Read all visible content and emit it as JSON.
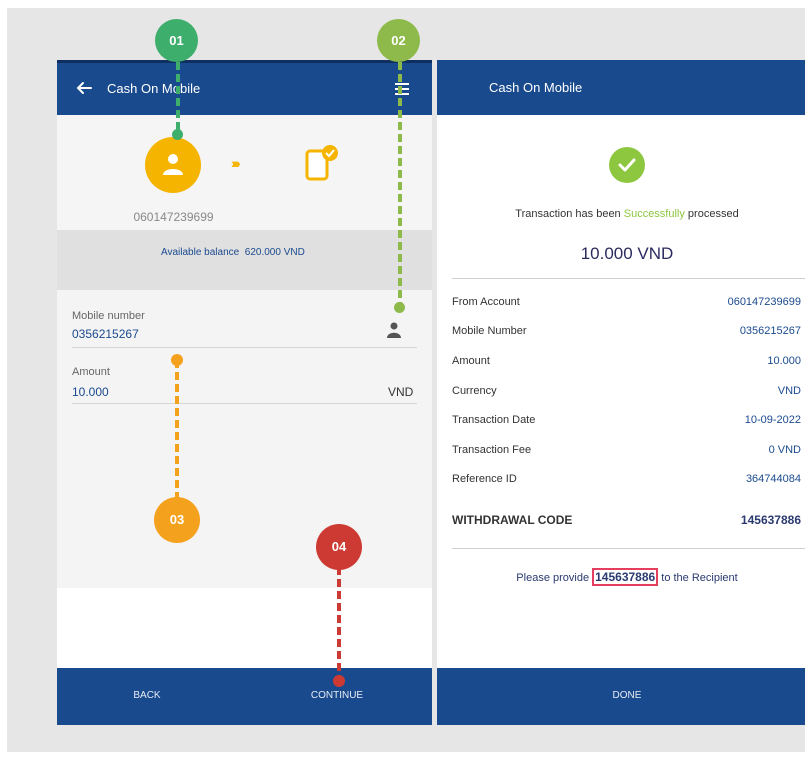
{
  "left_screen": {
    "title": "Cash On Mobile",
    "account_number": "060147239699",
    "balance_label": "Available balance",
    "balance_value": "620.000 VND",
    "mobile_label": "Mobile number",
    "mobile_value": "0356215267",
    "amount_label": "Amount",
    "amount_value": "10.000",
    "currency": "VND",
    "back_label": "BACK",
    "continue_label": "CONTINUE"
  },
  "right_screen": {
    "title": "Cash On Mobile",
    "success_prefix": "Transaction has been ",
    "success_word": "Successfully",
    "success_suffix": " processed",
    "amount": "10.000 VND",
    "details": [
      {
        "label": "From Account",
        "value": "060147239699"
      },
      {
        "label": "Mobile Number",
        "value": "0356215267"
      },
      {
        "label": "Amount",
        "value": "10.000"
      },
      {
        "label": "Currency",
        "value": "VND"
      },
      {
        "label": "Transaction Date",
        "value": "10-09-2022"
      },
      {
        "label": "Transaction Fee",
        "value": "0 VND"
      },
      {
        "label": "Reference ID",
        "value": "364744084"
      }
    ],
    "withdrawal_label": "WITHDRAWAL CODE",
    "withdrawal_code": "145637886",
    "provide_prefix": "Please provide ",
    "provide_code": "145637886",
    "provide_suffix": " to the Recipient",
    "done_label": "DONE"
  },
  "callouts": {
    "c1": "01",
    "c2": "02",
    "c3": "03",
    "c4": "04"
  },
  "colors": {
    "brand_blue": "#1a4a8e",
    "success_green": "#8dc63f",
    "callout_1": "#3dae6b",
    "callout_2": "#8dba4a",
    "callout_3": "#f4a21d",
    "callout_4": "#cc3a33",
    "highlight_box": "#e53e5e"
  },
  "icons": {
    "back": "arrow-left-icon",
    "menu": "hamburger-menu-icon",
    "user": "user-icon",
    "transfer": "chevrons-right-icon",
    "phone_check": "phone-check-icon",
    "contact": "contact-person-icon",
    "success": "check-circle-icon"
  }
}
